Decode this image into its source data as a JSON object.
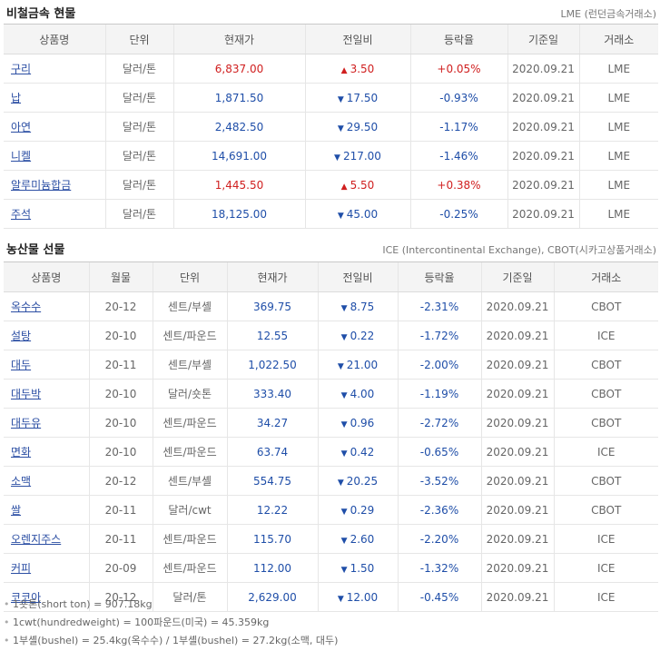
{
  "metals": {
    "title": "비철금속 현물",
    "source": "LME (런던금속거래소)",
    "headers": [
      "상품명",
      "단위",
      "현재가",
      "전일비",
      "등락율",
      "기준일",
      "거래소"
    ],
    "rows": [
      {
        "name": "구리",
        "unit": "달러/톤",
        "price": "6,837.00",
        "dir": "up",
        "change": "3.50",
        "rate": "+0.05%",
        "date": "2020.09.21",
        "exchange": "LME"
      },
      {
        "name": "납",
        "unit": "달러/톤",
        "price": "1,871.50",
        "dir": "down",
        "change": "17.50",
        "rate": "-0.93%",
        "date": "2020.09.21",
        "exchange": "LME"
      },
      {
        "name": "아연",
        "unit": "달러/톤",
        "price": "2,482.50",
        "dir": "down",
        "change": "29.50",
        "rate": "-1.17%",
        "date": "2020.09.21",
        "exchange": "LME"
      },
      {
        "name": "니켈",
        "unit": "달러/톤",
        "price": "14,691.00",
        "dir": "down",
        "change": "217.00",
        "rate": "-1.46%",
        "date": "2020.09.21",
        "exchange": "LME"
      },
      {
        "name": "알루미늄합금",
        "unit": "달러/톤",
        "price": "1,445.50",
        "dir": "up",
        "change": "5.50",
        "rate": "+0.38%",
        "date": "2020.09.21",
        "exchange": "LME"
      },
      {
        "name": "주석",
        "unit": "달러/톤",
        "price": "18,125.00",
        "dir": "down",
        "change": "45.00",
        "rate": "-0.25%",
        "date": "2020.09.21",
        "exchange": "LME"
      }
    ]
  },
  "agri": {
    "title": "농산물 선물",
    "source": "ICE (Intercontinental Exchange), CBOT(시카고상품거래소)",
    "headers": [
      "상품명",
      "월물",
      "단위",
      "현재가",
      "전일비",
      "등락율",
      "기준일",
      "거래소"
    ],
    "rows": [
      {
        "name": "옥수수",
        "month": "20-12",
        "unit": "센트/부셸",
        "price": "369.75",
        "dir": "down",
        "change": "8.75",
        "rate": "-2.31%",
        "date": "2020.09.21",
        "exchange": "CBOT"
      },
      {
        "name": "설탕",
        "month": "20-10",
        "unit": "센트/파운드",
        "price": "12.55",
        "dir": "down",
        "change": "0.22",
        "rate": "-1.72%",
        "date": "2020.09.21",
        "exchange": "ICE"
      },
      {
        "name": "대두",
        "month": "20-11",
        "unit": "센트/부셸",
        "price": "1,022.50",
        "dir": "down",
        "change": "21.00",
        "rate": "-2.00%",
        "date": "2020.09.21",
        "exchange": "CBOT"
      },
      {
        "name": "대두박",
        "month": "20-10",
        "unit": "달러/숏톤",
        "price": "333.40",
        "dir": "down",
        "change": "4.00",
        "rate": "-1.19%",
        "date": "2020.09.21",
        "exchange": "CBOT"
      },
      {
        "name": "대두유",
        "month": "20-10",
        "unit": "센트/파운드",
        "price": "34.27",
        "dir": "down",
        "change": "0.96",
        "rate": "-2.72%",
        "date": "2020.09.21",
        "exchange": "CBOT"
      },
      {
        "name": "면화",
        "month": "20-10",
        "unit": "센트/파운드",
        "price": "63.74",
        "dir": "down",
        "change": "0.42",
        "rate": "-0.65%",
        "date": "2020.09.21",
        "exchange": "ICE"
      },
      {
        "name": "소맥",
        "month": "20-12",
        "unit": "센트/부셸",
        "price": "554.75",
        "dir": "down",
        "change": "20.25",
        "rate": "-3.52%",
        "date": "2020.09.21",
        "exchange": "CBOT"
      },
      {
        "name": "쌀",
        "month": "20-11",
        "unit": "달러/cwt",
        "price": "12.22",
        "dir": "down",
        "change": "0.29",
        "rate": "-2.36%",
        "date": "2020.09.21",
        "exchange": "CBOT"
      },
      {
        "name": "오렌지주스",
        "month": "20-11",
        "unit": "센트/파운드",
        "price": "115.70",
        "dir": "down",
        "change": "2.60",
        "rate": "-2.20%",
        "date": "2020.09.21",
        "exchange": "ICE"
      },
      {
        "name": "커피",
        "month": "20-09",
        "unit": "센트/파운드",
        "price": "112.00",
        "dir": "down",
        "change": "1.50",
        "rate": "-1.32%",
        "date": "2020.09.21",
        "exchange": "ICE"
      },
      {
        "name": "코코아",
        "month": "20-12",
        "unit": "달러/톤",
        "price": "2,629.00",
        "dir": "down",
        "change": "12.00",
        "rate": "-0.45%",
        "date": "2020.09.21",
        "exchange": "ICE"
      }
    ]
  },
  "notes": [
    "1숏톤(short ton) = 907.18kg",
    "1cwt(hundredweight) = 100파운드(미국) = 45.359kg",
    "1부셸(bushel) = 25.4kg(옥수수) / 1부셸(bushel) = 27.2kg(소맥, 대두)"
  ],
  "colors": {
    "up": "#d02020",
    "down": "#1f4ea8",
    "link": "#2b4ea3"
  }
}
